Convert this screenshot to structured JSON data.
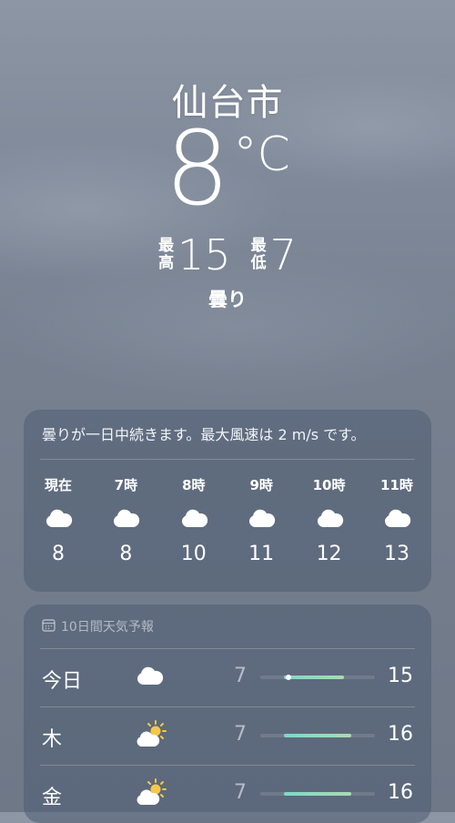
{
  "current": {
    "city": "仙台市",
    "temperature": "8",
    "unit": "°C",
    "high_label": [
      "最",
      "高"
    ],
    "high": "15",
    "low_label": [
      "最",
      "低"
    ],
    "low": "7",
    "condition": "曇り"
  },
  "hourly": {
    "summary": "曇りが一日中続きます。最大風速は 2 m/s です。",
    "items": [
      {
        "time": "現在",
        "icon": "cloud-icon",
        "temp": "8"
      },
      {
        "time": "7時",
        "icon": "cloud-icon",
        "temp": "8"
      },
      {
        "time": "8時",
        "icon": "cloud-icon",
        "temp": "10"
      },
      {
        "time": "9時",
        "icon": "cloud-icon",
        "temp": "11"
      },
      {
        "time": "10時",
        "icon": "cloud-icon",
        "temp": "12"
      },
      {
        "time": "11時",
        "icon": "cloud-icon",
        "temp": "13"
      }
    ]
  },
  "forecast": {
    "title": "10日間天気予報",
    "days": [
      {
        "day": "今日",
        "icon": "cloud-icon",
        "low": "7",
        "high": "15",
        "current_marker": 0.25
      },
      {
        "day": "木",
        "icon": "partly-sunny-icon",
        "low": "7",
        "high": "16"
      },
      {
        "day": "金",
        "icon": "partly-sunny-icon",
        "low": "7",
        "high": "16"
      }
    ]
  }
}
